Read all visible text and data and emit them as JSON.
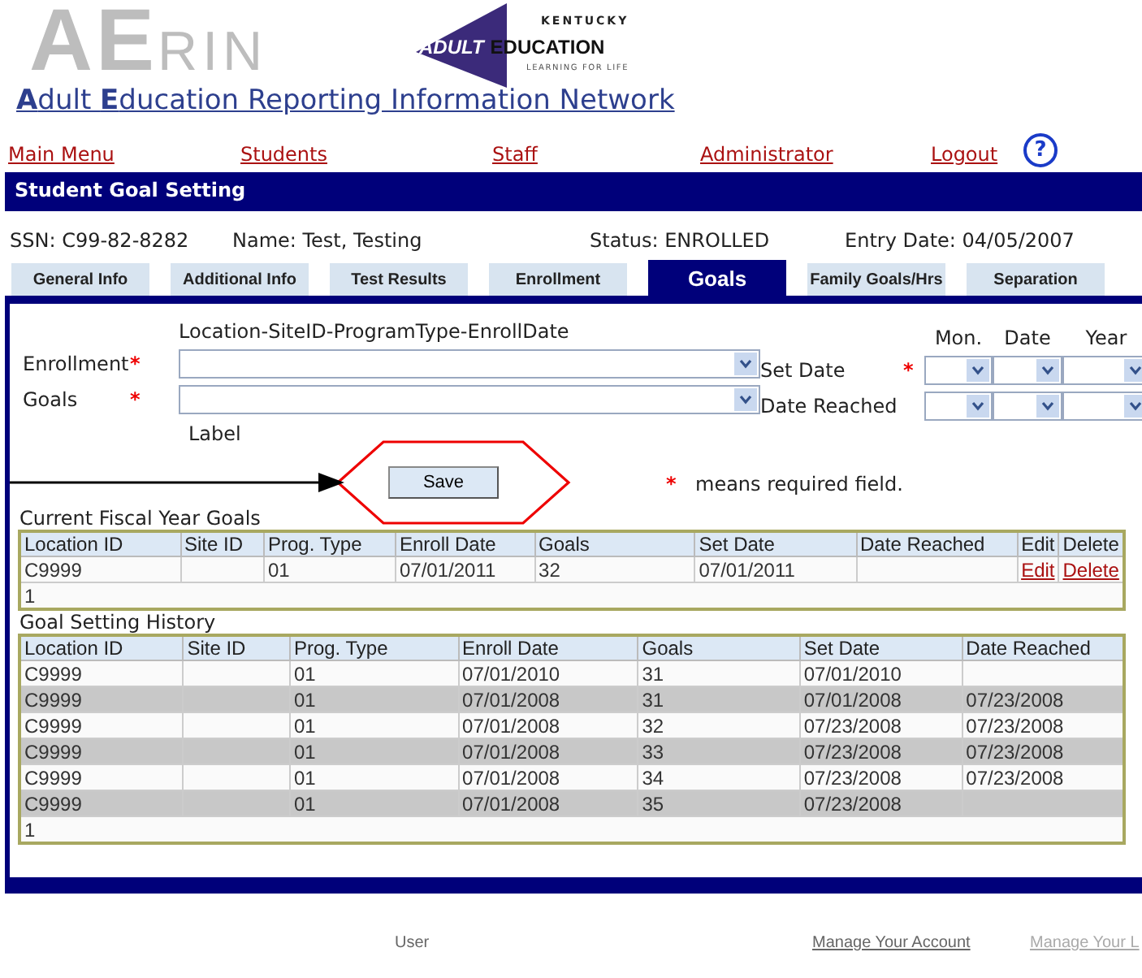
{
  "header": {
    "logo_big": "AE",
    "logo_small": "RIN",
    "partner_logo": {
      "top": "KENTUCKY",
      "left": "ADULT",
      "right": "EDUCATION",
      "bottom": "LEARNING FOR LIFE"
    },
    "title": "**A**dult **E**ducation Reporting Information Network"
  },
  "nav": [
    {
      "label": "Main Menu"
    },
    {
      "label": "Students"
    },
    {
      "label": "Staff"
    },
    {
      "label": "Administrator"
    },
    {
      "label": "Logout"
    }
  ],
  "help": "?",
  "page_title": "Student Goal Setting",
  "info": [
    "SSN: C99-82-8282",
    "Name: Test, Testing",
    "Status: ENROLLED",
    "Entry Date: 04/05/2007"
  ],
  "tabs": [
    {
      "label": "General Info",
      "selected": false
    },
    {
      "label": "Additional Info",
      "selected": false
    },
    {
      "label": "Test Results",
      "selected": false
    },
    {
      "label": "Enrollment",
      "selected": false
    },
    {
      "label": "Goals",
      "selected": true
    },
    {
      "label": "Family Goals/Hrs",
      "selected": false
    },
    {
      "label": "Separation",
      "selected": false
    }
  ],
  "form": {
    "hint": "Location-SiteID-ProgramType-EnrollDate",
    "rows": [
      {
        "label": "Enrollment",
        "mark": "*"
      },
      {
        "label": "Goals",
        "mark": "*"
      }
    ],
    "sublabel": "Label",
    "date_headers": [
      "Mon.",
      "Date",
      "Year"
    ],
    "date_rows": [
      {
        "label": "Set Date",
        "mark": "*"
      },
      {
        "label": "Date Reached"
      }
    ],
    "save": "Save",
    "note_mark": "*",
    "note": "means required field."
  },
  "current": {
    "title": "Current Fiscal Year Goals",
    "columns": [
      "Location ID",
      "Site ID",
      "Prog. Type",
      "Enroll Date",
      "Goals",
      "Set Date",
      "Date Reached",
      "Edit",
      "Delete"
    ],
    "rows": [
      [
        "C9999",
        "",
        "01",
        "07/01/2011",
        "32",
        "07/01/2011",
        "",
        "Edit",
        "Delete"
      ]
    ],
    "pager": "1"
  },
  "history": {
    "title": "Goal Setting History",
    "columns": [
      "Location ID",
      "Site ID",
      "Prog. Type",
      "Enroll Date",
      "Goals",
      "Set Date",
      "Date Reached"
    ],
    "rows": [
      [
        "C9999",
        "",
        "01",
        "07/01/2010",
        "31",
        "07/01/2010",
        ""
      ],
      [
        "C9999",
        "",
        "01",
        "07/01/2008",
        "31",
        "07/01/2008",
        "07/23/2008"
      ],
      [
        "C9999",
        "",
        "01",
        "07/01/2008",
        "32",
        "07/23/2008",
        "07/23/2008"
      ],
      [
        "C9999",
        "",
        "01",
        "07/01/2008",
        "33",
        "07/23/2008",
        "07/23/2008"
      ],
      [
        "C9999",
        "",
        "01",
        "07/01/2008",
        "34",
        "07/23/2008",
        "07/23/2008"
      ],
      [
        "C9999",
        "",
        "01",
        "07/01/2008",
        "35",
        "07/23/2008",
        ""
      ]
    ],
    "pager": "1"
  },
  "footer": [
    "User",
    "Manage Your Account",
    "Manage Your L"
  ]
}
